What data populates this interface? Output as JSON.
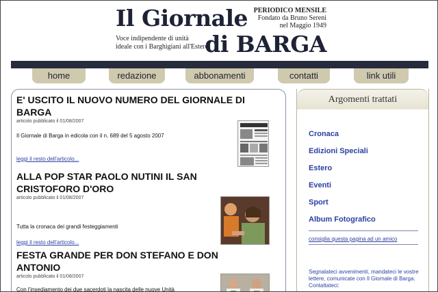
{
  "masthead": {
    "title_line1": "Il Giornale",
    "title_line2": "di BARGA",
    "tagline_1": "Voce indipendente di unità",
    "tagline_2": "ideale con i Barghigiani all'Estero",
    "note_1": "PERIODICO MENSILE",
    "note_2": "Fondato da Bruno Sereni",
    "note_3": "nel Maggio 1949"
  },
  "nav": {
    "home": "home",
    "redazione": "redazione",
    "abbonamenti": "abbonamenti",
    "contatti": "contatti",
    "link_utili": "link utili"
  },
  "articles": [
    {
      "title": "E' USCITO IL NUOVO NUMERO DEL GIORNALE DI BARGA",
      "meta": "articolo pubblicato il 01/08/2007",
      "body": "Il Giornale di Barga in edicola con il n. 689 del 5 agosto 2007",
      "link": "leggi il resto dell'articolo..."
    },
    {
      "title": "ALLA POP STAR PAOLO NUTINI IL SAN CRISTOFORO D'ORO",
      "meta": "articolo pubblicato il 01/08/2007",
      "body": "Tutta la cronaca dei grandi festeggiamenti",
      "link": "leggi il resto dell'articolo..."
    },
    {
      "title": "FESTA GRANDE PER DON STEFANO E DON ANTONIO",
      "meta": "articolo pubblicato il 01/08/2007",
      "body": "Con l'insediamento dei due sacerdoti la nascita delle nuove Unità"
    }
  ],
  "sidebar": {
    "heading": "Argomenti trattati",
    "items": [
      "Cronaca",
      "Edizioni Speciali",
      "Estero",
      "Eventi",
      "Sport",
      "Album Fotografico"
    ],
    "recommend_link": "consiglia questa pagina ad un amico",
    "note": "Segnalateci avvenimenti, mandateci le vostre lettere, comunicate con Il Giornale di Barga. Contattateci:"
  },
  "colors": {
    "navy": "#262b3d",
    "tab": "#cfc9ae",
    "link": "#2a3fa0"
  }
}
